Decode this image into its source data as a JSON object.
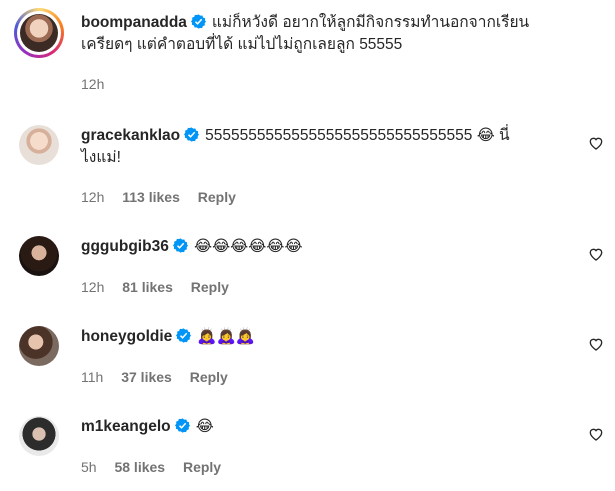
{
  "caption": {
    "username": "boompanadda",
    "text_line1": "แม่ก็หวังดี อยากให้ลูกมีกิจกรรมทำนอกจากเรียน",
    "text_line2": "เครียดๆ แต่คำตอบที่ได้ แม่ไปไม่ถูกเลยลูก 55555",
    "time": "12h"
  },
  "comments": [
    {
      "username": "gracekanklao",
      "text_line1": "5555555555555555555555555555555 😂 นี่",
      "text_line2": "ไงแม่!",
      "time": "12h",
      "likes": "113 likes",
      "reply": "Reply"
    },
    {
      "username": "gggubgib36",
      "text_line1": "😂😂😂😂😂😂",
      "time": "12h",
      "likes": "81 likes",
      "reply": "Reply"
    },
    {
      "username": "honeygoldie",
      "text_line1": "🙇‍♀️🙇‍♀️🙇‍♀️",
      "time": "11h",
      "likes": "37 likes",
      "reply": "Reply"
    },
    {
      "username": "m1keangelo",
      "text_line1": "😂",
      "time": "5h",
      "likes": "58 likes",
      "reply": "Reply"
    }
  ],
  "icons": {
    "verified": "verified-badge-icon",
    "like": "heart-icon"
  },
  "colors": {
    "verified": "#0095f6",
    "text": "#262626",
    "meta": "#737373"
  }
}
